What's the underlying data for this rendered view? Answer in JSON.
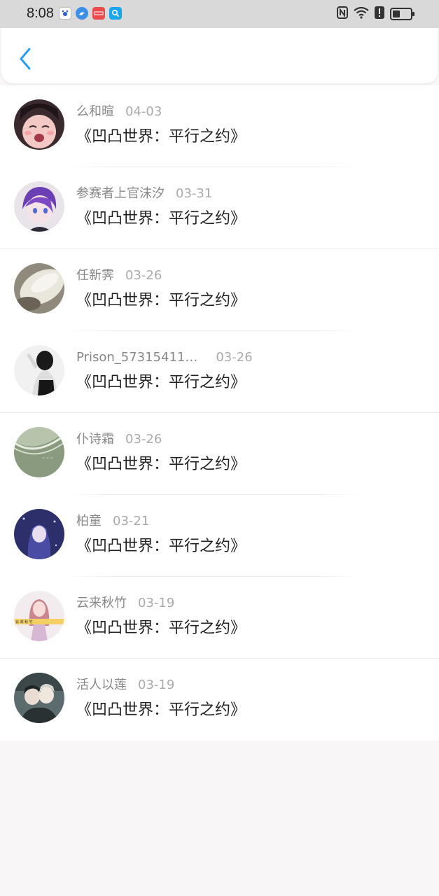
{
  "status_bar": {
    "time": "8:08",
    "notification_icons": [
      "baidu-icon",
      "bluebird-icon",
      "app-red-icon",
      "search-icon"
    ],
    "right_icons": [
      "nfc-icon",
      "wifi-icon",
      "alert-icon",
      "battery-icon"
    ]
  },
  "header": {
    "back_icon": "chevron-left-icon",
    "accent_color": "#2a9df4"
  },
  "list": {
    "items": [
      {
        "name": "么和暄",
        "date": "04-03",
        "title": "《凹凸世界：平行之约》",
        "avatar": "anime-crying-girl"
      },
      {
        "name": "参赛者上官沫汐",
        "date": "03-31",
        "title": "《凹凸世界：平行之约》",
        "avatar": "anime-purple-hair"
      },
      {
        "name": "任新霁",
        "date": "03-26",
        "title": "《凹凸世界：平行之约》",
        "avatar": "blurred-feather"
      },
      {
        "name": "Prison_57315411…",
        "date": "03-26",
        "title": "《凹凸世界：平行之约》",
        "avatar": "monochrome-woman"
      },
      {
        "name": "仆诗霜",
        "date": "03-26",
        "title": "《凹凸世界：平行之约》",
        "avatar": "green-beach"
      },
      {
        "name": "柏童",
        "date": "03-21",
        "title": "《凹凸世界：平行之约》",
        "avatar": "anime-night-girl"
      },
      {
        "name": "云来秋竹",
        "date": "03-19",
        "title": "《凹凸世界：平行之约》",
        "avatar": "pink-hair-girl"
      },
      {
        "name": "活人以莲",
        "date": "03-19",
        "title": "《凹凸世界：平行之约》",
        "avatar": "two-people-photo"
      }
    ]
  }
}
